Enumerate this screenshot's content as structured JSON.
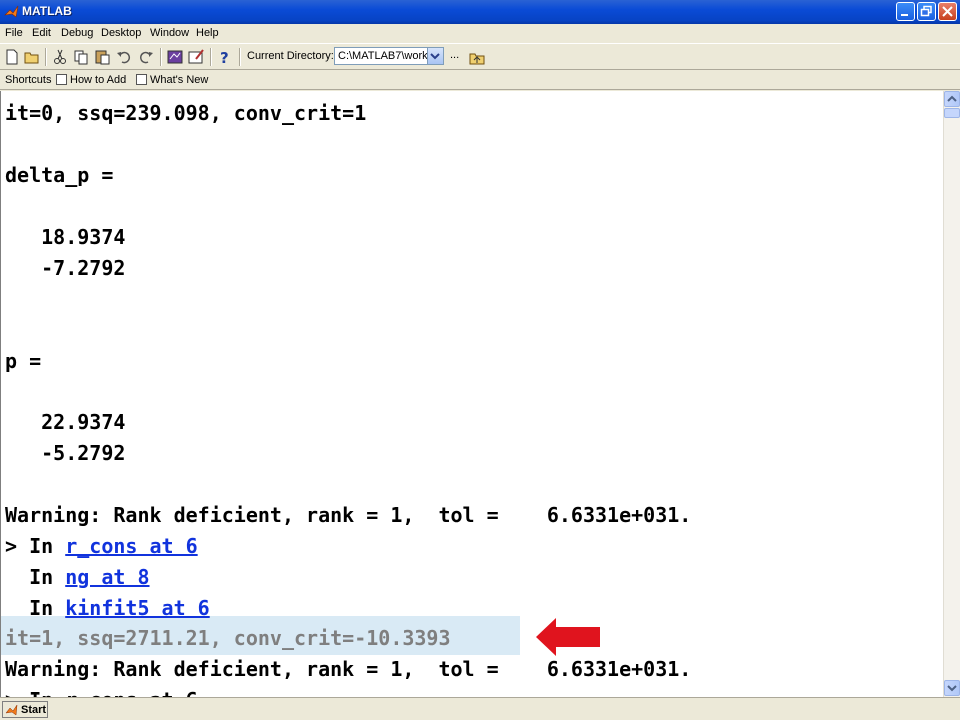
{
  "window": {
    "title": "MATLAB"
  },
  "menu": [
    "File",
    "Edit",
    "Debug",
    "Desktop",
    "Window",
    "Help"
  ],
  "toolbar": {
    "current_directory_label": "Current Directory:",
    "current_directory_value": "C:\\MATLAB7\\work",
    "browse_label": "..."
  },
  "shortcuts": {
    "label": "Shortcuts",
    "items": [
      "How to Add",
      "What's New"
    ]
  },
  "command_window": {
    "lines": [
      "it=0, ssq=239.098, conv_crit=1",
      "delta_p =",
      "   18.9374",
      "   -7.2792",
      "p =",
      "   22.9374",
      "   -5.2792",
      "Warning: Rank deficient, rank = 1,  tol =    6.6331e+031."
    ],
    "warning_in_1_prefix": "> In ",
    "warning_in_1_link": "r_cons at 6",
    "warning_in_2_prefix": "  In ",
    "warning_in_2_link": "ng at 8",
    "warning_in_3_prefix": "  In ",
    "warning_in_3_link": "kinfit5 at 6",
    "highlighted_line": "it=1, ssq=2711.21, conv_crit=-10.3393",
    "warning_2": "Warning: Rank deficient, rank = 1,  tol =    6.6331e+031.",
    "partial_line": "> In r_cons at 6"
  },
  "statusbar": {
    "start_label": "Start"
  },
  "colors": {
    "titlebar": "#0a4bd6",
    "link": "#1133dd",
    "highlight": "#d9eaf5",
    "arrow": "#e0141e"
  }
}
